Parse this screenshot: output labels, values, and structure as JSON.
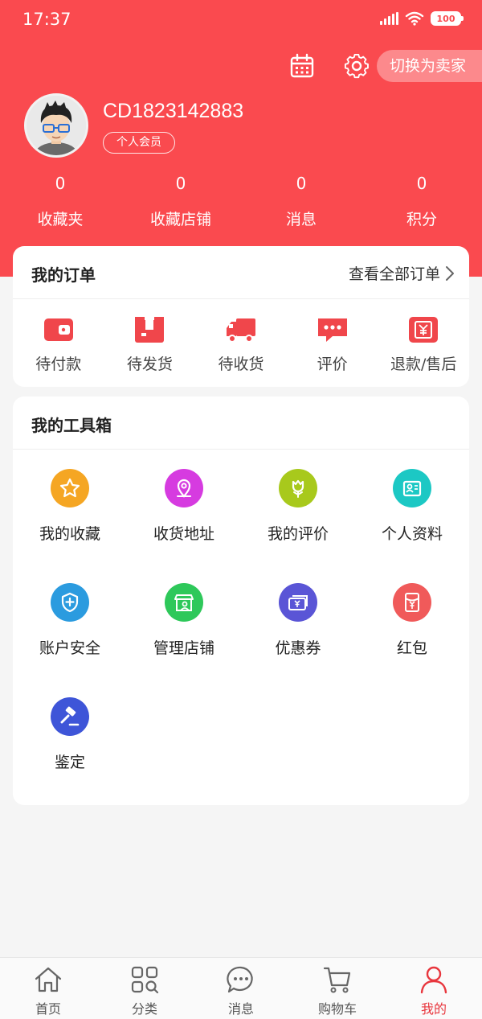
{
  "status_bar": {
    "time": "17:37",
    "battery": "100"
  },
  "header": {
    "switch_label": "切换为卖家",
    "calendar_icon": "calendar-icon",
    "settings_icon": "gear-icon"
  },
  "profile": {
    "username": "CD1823142883",
    "member_badge": "个人会员"
  },
  "stats": [
    {
      "value": "0",
      "label": "收藏夹"
    },
    {
      "value": "0",
      "label": "收藏店铺"
    },
    {
      "value": "0",
      "label": "消息"
    },
    {
      "value": "0",
      "label": "积分"
    }
  ],
  "orders": {
    "title": "我的订单",
    "view_all": "查看全部订单",
    "items": [
      {
        "label": "待付款",
        "icon": "wallet-icon"
      },
      {
        "label": "待发货",
        "icon": "package-icon"
      },
      {
        "label": "待收货",
        "icon": "truck-icon"
      },
      {
        "label": "评价",
        "icon": "comment-icon"
      },
      {
        "label": "退款/售后",
        "icon": "refund-icon"
      }
    ]
  },
  "tools": {
    "title": "我的工具箱",
    "items": [
      {
        "label": "我的收藏",
        "icon": "star-icon",
        "color": "#f5a623"
      },
      {
        "label": "收货地址",
        "icon": "location-icon",
        "color": "#d63be0"
      },
      {
        "label": "我的评价",
        "icon": "flower-icon",
        "color": "#a8c91c"
      },
      {
        "label": "个人资料",
        "icon": "profile-card-icon",
        "color": "#1cc8c4"
      },
      {
        "label": "账户安全",
        "icon": "shield-icon",
        "color": "#2b9bdf"
      },
      {
        "label": "管理店铺",
        "icon": "store-icon",
        "color": "#2ec85a"
      },
      {
        "label": "优惠券",
        "icon": "coupon-icon",
        "color": "#5a55d6"
      },
      {
        "label": "红包",
        "icon": "red-packet-icon",
        "color": "#f05a5a"
      },
      {
        "label": "鉴定",
        "icon": "gavel-icon",
        "color": "#3e55d8"
      }
    ]
  },
  "bottom_nav": [
    {
      "label": "首页",
      "icon": "home-icon"
    },
    {
      "label": "分类",
      "icon": "category-icon"
    },
    {
      "label": "消息",
      "icon": "message-icon"
    },
    {
      "label": "购物车",
      "icon": "cart-icon"
    },
    {
      "label": "我的",
      "icon": "user-icon",
      "active": true
    }
  ],
  "colors": {
    "brand_red": "#fa4a4f",
    "nav_active": "#e8363d"
  }
}
